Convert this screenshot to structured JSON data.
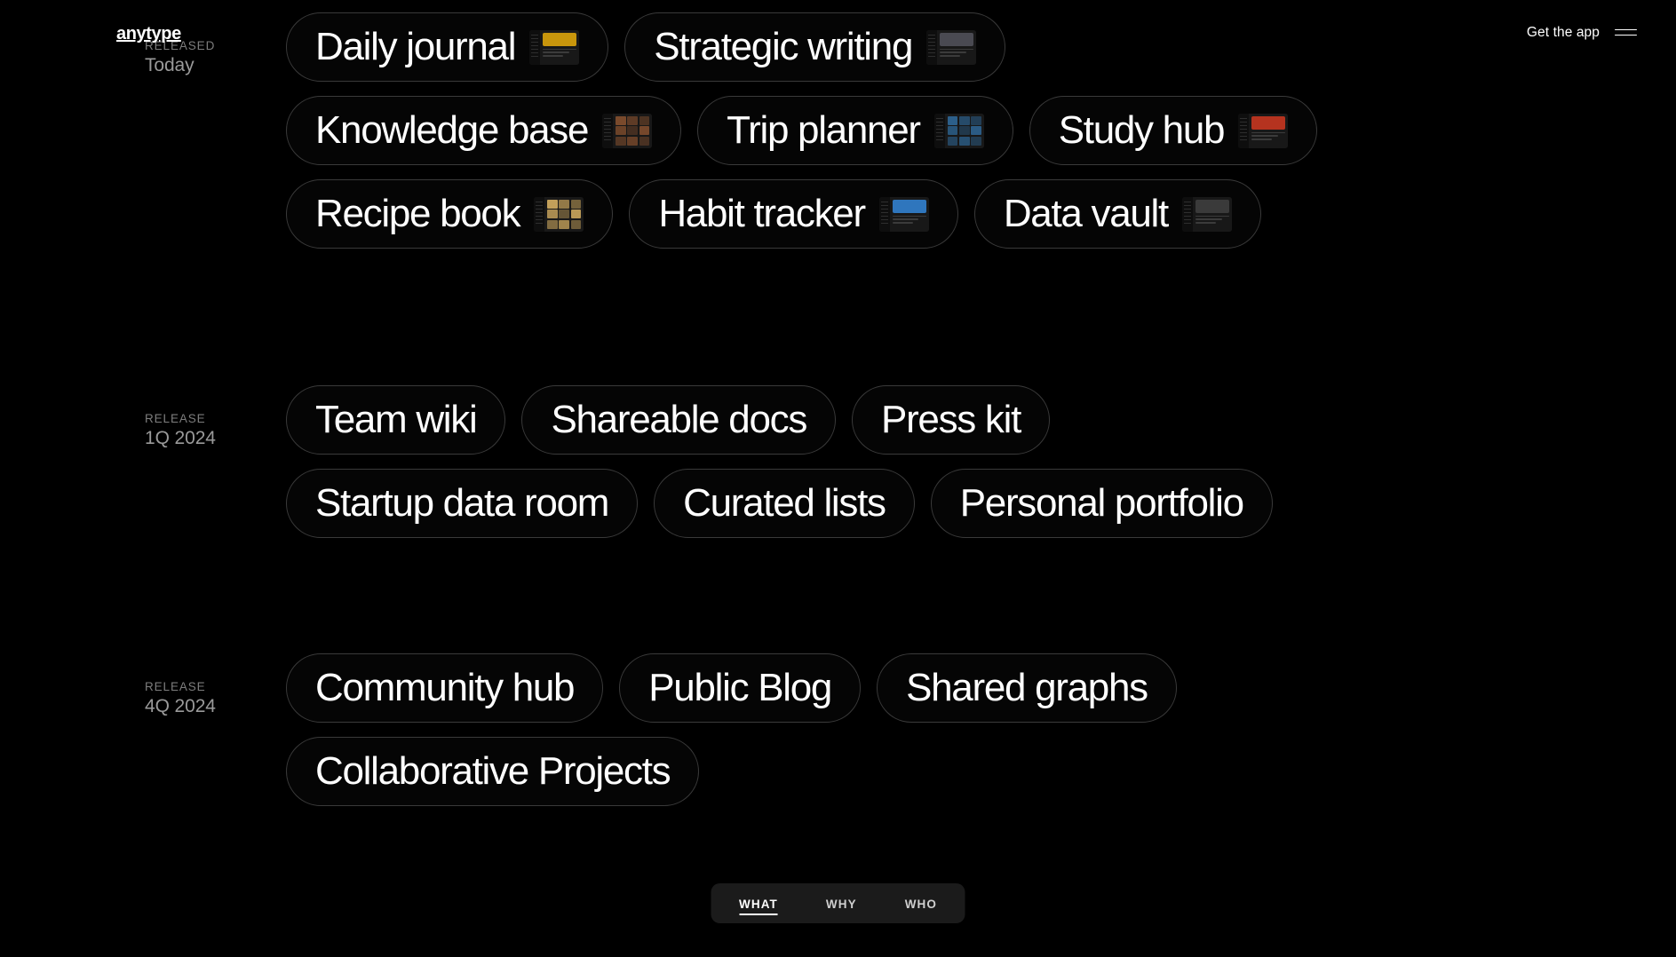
{
  "header": {
    "brand": "anytype",
    "get_app_label": "Get the app",
    "menu_icon": "hamburger-menu-icon"
  },
  "colors": {
    "background": "#000000",
    "pill_border": "#3a3a3a",
    "text": "#ffffff",
    "meta_text": "#9a9a9a",
    "kicker_text": "#7d7d7d",
    "tabbar_background": "#1b1b1b"
  },
  "sections": [
    {
      "kicker": "RELEASED",
      "when": "Today",
      "rows": [
        [
          {
            "label": "Daily journal",
            "thumb": "thumb-daily-journal",
            "accent": "#c9960c",
            "style": "hero"
          },
          {
            "label": "Strategic writing",
            "thumb": "thumb-strategic-writing",
            "accent": "#4a4a52",
            "style": "doc"
          }
        ],
        [
          {
            "label": "Knowledge base",
            "thumb": "thumb-knowledge-base",
            "accent": "#7a4a2c",
            "style": "grid"
          },
          {
            "label": "Trip planner",
            "thumb": "thumb-trip-planner",
            "accent": "#2c5f8a",
            "style": "grid"
          },
          {
            "label": "Study hub",
            "thumb": "thumb-study-hub",
            "accent": "#b5331f",
            "style": "hero"
          }
        ],
        [
          {
            "label": "Recipe book",
            "thumb": "thumb-recipe-book",
            "accent": "#c3a05a",
            "style": "grid"
          },
          {
            "label": "Habit tracker",
            "thumb": "thumb-habit-tracker",
            "accent": "#2f76bd",
            "style": "hero"
          },
          {
            "label": "Data vault",
            "thumb": "thumb-data-vault",
            "accent": "#3a3a3a",
            "style": "doc"
          }
        ]
      ]
    },
    {
      "kicker": "RELEASE",
      "when": "1Q 2024",
      "rows": [
        [
          {
            "label": "Team wiki"
          },
          {
            "label": "Shareable docs"
          },
          {
            "label": "Press kit"
          }
        ],
        [
          {
            "label": "Startup data room"
          },
          {
            "label": "Curated lists"
          },
          {
            "label": "Personal portfolio"
          }
        ]
      ]
    },
    {
      "kicker": "RELEASE",
      "when": "4Q 2024",
      "rows": [
        [
          {
            "label": "Community hub"
          },
          {
            "label": "Public Blog"
          },
          {
            "label": "Shared graphs"
          }
        ],
        [
          {
            "label": "Collaborative Projects"
          }
        ]
      ]
    }
  ],
  "tabbar": {
    "tabs": [
      {
        "label": "WHAT",
        "active": true
      },
      {
        "label": "WHY",
        "active": false
      },
      {
        "label": "WHO",
        "active": false
      }
    ]
  }
}
